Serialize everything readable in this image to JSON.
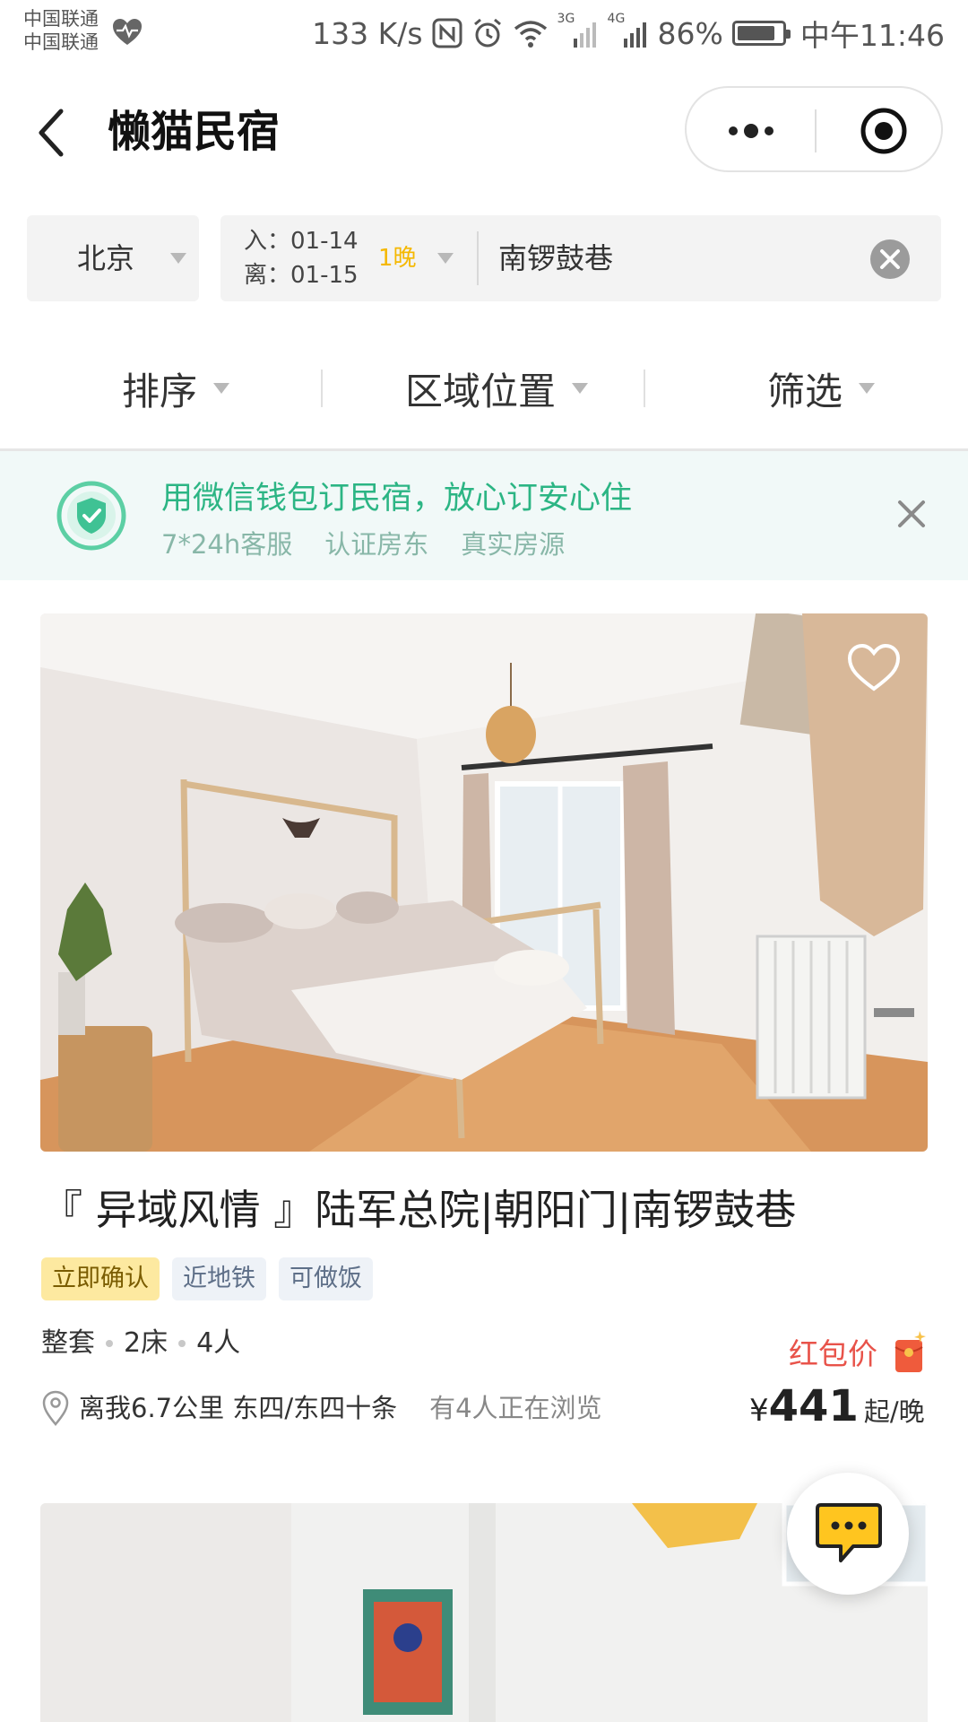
{
  "status_bar": {
    "carrier_1": "中国联通",
    "carrier_2": "中国联通",
    "net_speed": "133 K/s",
    "signal_3g": "3G",
    "signal_4g": "4G",
    "battery_percent": "86%",
    "battery_level": 0.86,
    "time": "中午11:46"
  },
  "titlebar": {
    "title": "懒猫民宿"
  },
  "search": {
    "city": "北京",
    "check_in": "入：01-14",
    "check_out": "离：01-15",
    "nights": "1晚",
    "keyword": "南锣鼓巷"
  },
  "filters": {
    "sort": "排序",
    "area": "区域位置",
    "filter": "筛选"
  },
  "banner": {
    "title": "用微信钱包订民宿，放心订安心住",
    "tags": [
      "7*24h客服",
      "认证房东",
      "真实房源"
    ]
  },
  "listing": {
    "title": "『 异域风情 』陆军总院|朝阳门|南锣鼓巷",
    "tags": [
      "立即确认",
      "近地铁",
      "可做饭"
    ],
    "type": "整套",
    "beds": "2床",
    "guests": "4人",
    "distance": "离我6.7公里 东四/东四十条",
    "viewers": "有4人正在浏览",
    "redpacket_label": "红包价",
    "currency": "¥",
    "price": "441",
    "price_unit": "起/晚"
  },
  "colors": {
    "accent_green": "#2cb584",
    "price_red": "#e8534a",
    "nights_yellow": "#f5b800",
    "tag_yellow": "#fde9a0"
  }
}
